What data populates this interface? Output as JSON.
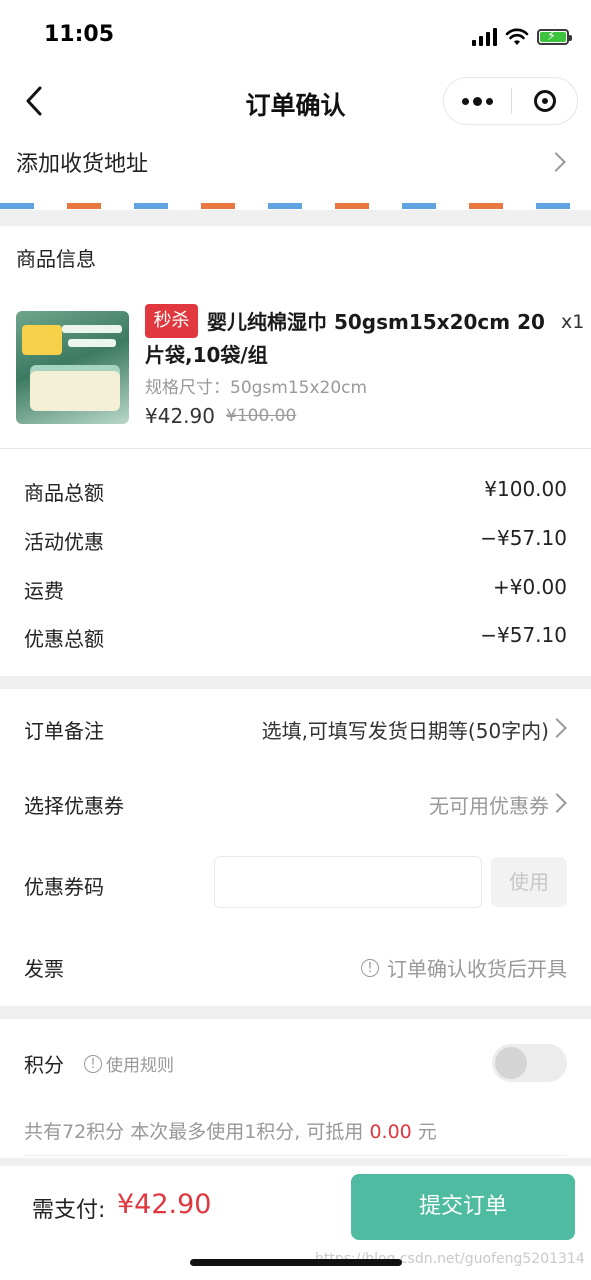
{
  "status_bar": {
    "time": "11:05"
  },
  "nav": {
    "title": "订单确认"
  },
  "address": {
    "label": "添加收货地址"
  },
  "product_section": {
    "title": "商品信息",
    "item": {
      "tag": "秒杀",
      "name": "婴儿纯棉湿巾 50gsm15x20cm 20片袋,10袋/组",
      "quantity": "x1",
      "spec": "规格尺寸：50gsm15x20cm",
      "price": "¥42.90",
      "original_price": "¥100.00"
    }
  },
  "summary": {
    "rows": [
      {
        "label": "商品总额",
        "value": "¥100.00"
      },
      {
        "label": "活动优惠",
        "value": "−¥57.10"
      },
      {
        "label": "运费",
        "value": "+¥0.00"
      },
      {
        "label": "优惠总额",
        "value": "−¥57.10"
      }
    ]
  },
  "options": {
    "remark": {
      "label": "订单备注",
      "placeholder": "选填,可填写发货日期等(50字内)"
    },
    "coupon": {
      "label": "选择优惠券",
      "value": "无可用优惠券"
    },
    "coupon_code": {
      "label": "优惠券码",
      "input_value": "",
      "button": "使用"
    },
    "invoice": {
      "label": "发票",
      "value": "订单确认收货后开具"
    }
  },
  "points": {
    "label": "积分",
    "rules": "使用规则",
    "desc_prefix": "共有72积分  本次最多使用1积分, 可抵用",
    "amount": "0.00",
    "unit": "元"
  },
  "footer": {
    "pay_label": "需支付:",
    "pay_amount": "¥42.90",
    "submit": "提交订单"
  },
  "watermark": "https://blog.csdn.net/guofeng5201314",
  "colors": {
    "accent": "#4fbba0",
    "price_red": "#e0383e",
    "gray_text": "#999999"
  },
  "icons": [
    "back-icon",
    "more-icon",
    "close-capsule-icon",
    "chevron-right-icon",
    "info-icon"
  ]
}
